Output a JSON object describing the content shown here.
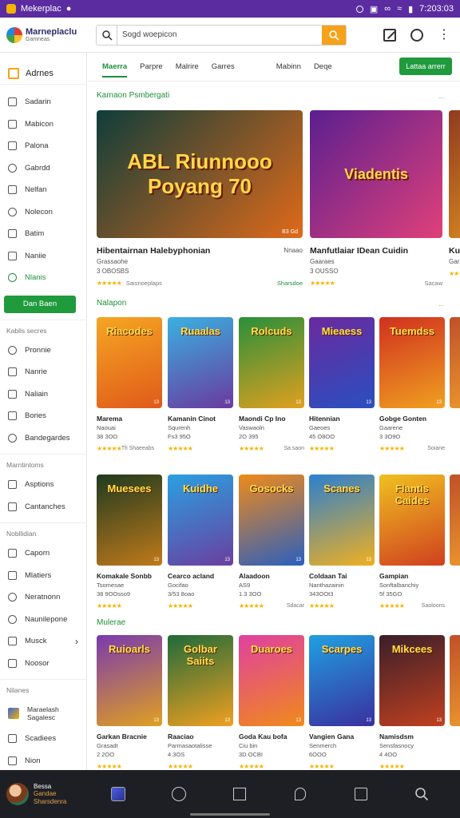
{
  "status_bar": {
    "app_name": "Mekerplac",
    "time": "7:203:03"
  },
  "brand": {
    "title": "Marneplaclu",
    "subtitle": "Gamneas"
  },
  "search": {
    "value": "Sogd woepicon"
  },
  "sidebar": {
    "header": "Adrnes",
    "items": [
      {
        "label": "Sadarin"
      },
      {
        "label": "Mabicon"
      },
      {
        "label": "Palona"
      },
      {
        "label": "Gabrdd"
      },
      {
        "label": "Nelfan"
      },
      {
        "label": "Nolecon"
      },
      {
        "label": "Batim"
      },
      {
        "label": "Naniie"
      },
      {
        "label": "Nlanis"
      }
    ],
    "cta": "Dan Baen",
    "section1": "Kablis secres",
    "section1_items": [
      {
        "label": "Pronnie"
      },
      {
        "label": "Nanrie"
      },
      {
        "label": "Naliain"
      },
      {
        "label": "Bories"
      },
      {
        "label": "Bandegardes"
      }
    ],
    "section2": "Marntintoms",
    "section2_items": [
      {
        "label": "Asptions"
      },
      {
        "label": "Cantanches"
      }
    ],
    "section3": "Nobllidian",
    "section3_items": [
      {
        "label": "Caporn"
      },
      {
        "label": "Mlatiers"
      },
      {
        "label": "Neratnonn"
      },
      {
        "label": "Naunilepone"
      },
      {
        "label": "Musck"
      },
      {
        "label": "Noosor"
      }
    ],
    "section4": "Nilanes",
    "section4_items": [
      {
        "label": "Maraelash Sagalesc"
      },
      {
        "label": "Scadiees"
      },
      {
        "label": "Nion"
      }
    ]
  },
  "tabs": [
    "Maerra",
    "Parpre",
    "Malrire",
    "Garres",
    "Mabinn",
    "Deqe"
  ],
  "tabs_cta": "Lattaa arrerr",
  "sections": {
    "featured": "Karnaon Psmbergati",
    "featured_more": "...",
    "row1": "Nalapon",
    "row1_more": "...",
    "row3": "Mulerae"
  },
  "featured": [
    {
      "title": "Hibentairnan Halebyphonian",
      "meta1": "Grassaohe",
      "meta2": "3 OBOSBS",
      "price": "Nnaao",
      "sub": "Saisnoeplaps",
      "right": "Sharsdoe",
      "badge": "B3 Gd",
      "art": "ABL Riunnooo Poyang 70",
      "c1": "#0f3d3a",
      "c2": "#e06a1a"
    },
    {
      "title": "Manfutlaiar IDean Cuidin",
      "meta1": "Gaaraes",
      "meta2": "3 OUSSO",
      "price": "",
      "sub": "",
      "right": "Sacaw",
      "badge": "",
      "art": "Viadentis",
      "c1": "#5a1f8f",
      "c2": "#e0407a"
    },
    {
      "title": "Kur",
      "meta1": "Garca",
      "meta2": "",
      "price": "",
      "sub": "",
      "right": "",
      "badge": "",
      "art": "",
      "c1": "#8f3a1f",
      "c2": "#e09020"
    }
  ],
  "grid_rows": [
    [
      {
        "title": "Marema",
        "sub": "Naouai",
        "price": "38 3OO",
        "left": "Tfi Shaeeabs",
        "right": "",
        "art": "Riacodes",
        "c1": "#f5a623",
        "c2": "#e05a1a",
        "tag": "13"
      },
      {
        "title": "Kamanin Cinot",
        "sub": "Squrenh",
        "price": "Fs3 95O",
        "left": "",
        "right": "",
        "art": "Ruaalas",
        "c1": "#3ab0e0",
        "c2": "#6a3a9f",
        "tag": "13"
      },
      {
        "title": "Maondi Cp Ino",
        "sub": "Vaswaoln",
        "price": "2O 395",
        "left": "",
        "right": "Sa.saon",
        "art": "Rolcuds",
        "c1": "#2a8f3a",
        "c2": "#e0a020",
        "tag": "13"
      },
      {
        "title": "Hitennian",
        "sub": "Gaeoes",
        "price": "45 O8OO",
        "left": "",
        "right": "",
        "art": "Mieaess",
        "c1": "#6a2a9f",
        "c2": "#2a4fbf",
        "tag": "13"
      },
      {
        "title": "Gobge Gonten",
        "sub": "Gaarene",
        "price": "3 3O9O",
        "left": "",
        "right": "Soiane",
        "art": "Tuemdss",
        "c1": "#d0301f",
        "c2": "#f0a020",
        "tag": "13"
      }
    ],
    [
      {
        "title": "Komakale Sonbb",
        "sub": "Tsomesae",
        "price": "38 9OOsso9",
        "left": "",
        "right": "",
        "art": "Muesees",
        "c1": "#1f3a1f",
        "c2": "#c07a1a",
        "tag": "13"
      },
      {
        "title": "Cearco acland",
        "sub": "Gocifao",
        "price": "3/53 8oao",
        "left": "",
        "right": "",
        "art": "Kuidhe",
        "c1": "#2aa0e0",
        "c2": "#6a3fa0",
        "tag": "13"
      },
      {
        "title": "Alaadoon",
        "sub": "AS9",
        "price": "1.3 3OO",
        "left": "",
        "right": "Sdacar",
        "art": "Gosocks",
        "c1": "#f08a1a",
        "c2": "#2a5fbf",
        "tag": "13"
      },
      {
        "title": "Coldaan Tai",
        "sub": "Nanthazainin",
        "price": "343OOt3",
        "left": "",
        "right": "",
        "art": "Scanes",
        "c1": "#2a7fd0",
        "c2": "#f0b020",
        "tag": "13"
      },
      {
        "title": "Gampian",
        "sub": "Sonftalbanchiy",
        "price": "5f 35GO",
        "left": "",
        "right": "Saoloons",
        "art": "Flantis Caides",
        "c1": "#f0c020",
        "c2": "#d0401f",
        "tag": ""
      }
    ],
    [
      {
        "title": "Garkan Bracnie",
        "sub": "Grasadt",
        "price": "2 2OO",
        "left": "",
        "right": "",
        "art": "Ruioarls",
        "c1": "#7a3aaf",
        "c2": "#e0a020",
        "tag": "13"
      },
      {
        "title": "Raaciao",
        "sub": "Parmasaotalisse",
        "price": "4.3OS",
        "left": "",
        "right": "",
        "art": "Golbar Saiits",
        "c1": "#1f6a3a",
        "c2": "#f0a020",
        "tag": "13"
      },
      {
        "title": "Goda Kau bofa",
        "sub": "Ciu bin",
        "price": "3D OCBI",
        "left": "",
        "right": "",
        "art": "Duaroes",
        "c1": "#e040a0",
        "c2": "#f08a1a",
        "tag": "13"
      },
      {
        "title": "Vangien Gana",
        "sub": "Senmerch",
        "price": "6OOO",
        "left": "",
        "right": "",
        "art": "Scarpes",
        "c1": "#20a0e0",
        "c2": "#3a2fa0",
        "tag": "13"
      },
      {
        "title": "Namisdsm",
        "sub": "Sensfasnocy",
        "price": "4 4OO",
        "left": "",
        "right": "",
        "art": "Mikcees",
        "c1": "#3a1f2a",
        "c2": "#c0401f",
        "tag": "13"
      }
    ]
  ],
  "bottom": {
    "user_name": "Bessa",
    "user_status": "Gandae",
    "user_sub": "Sharsdenra"
  }
}
